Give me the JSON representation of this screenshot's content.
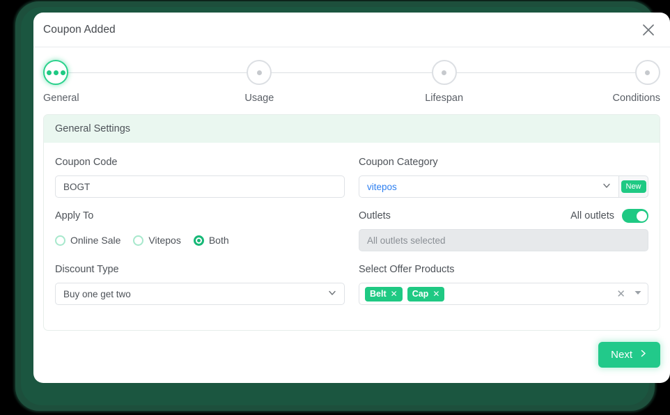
{
  "modal": {
    "title": "Coupon Added",
    "close_icon": "close-icon"
  },
  "stepper": {
    "steps": [
      {
        "label": "General",
        "state": "active"
      },
      {
        "label": "Usage",
        "state": "inactive"
      },
      {
        "label": "Lifespan",
        "state": "inactive"
      },
      {
        "label": "Conditions",
        "state": "inactive"
      }
    ]
  },
  "panel": {
    "header": "General Settings",
    "fields": {
      "coupon_code": {
        "label": "Coupon Code",
        "value": "BOGT",
        "placeholder": "Coupon Code"
      },
      "coupon_category": {
        "label": "Coupon Category",
        "value": "vitepos",
        "new_button": "New",
        "caret_icon": "chevron-down-icon"
      },
      "apply_to": {
        "label": "Apply To",
        "options": [
          {
            "label": "Online Sale",
            "selected": false
          },
          {
            "label": "Vitepos",
            "selected": false
          },
          {
            "label": "Both",
            "selected": true
          }
        ]
      },
      "outlets": {
        "label": "Outlets",
        "toggle_label": "All outlets",
        "toggle_on": true,
        "value": "All outlets selected",
        "disabled": true
      },
      "discount_type": {
        "label": "Discount Type",
        "value": "Buy one get two",
        "caret_icon": "chevron-down-icon"
      },
      "offer_products": {
        "label": "Select Offer Products",
        "tags": [
          "Belt",
          "Cap"
        ],
        "remove_icon": "close-small-icon",
        "clear_icon": "clear-icon",
        "caret_icon": "caret-down-icon"
      }
    }
  },
  "footer": {
    "next_label": "Next",
    "next_icon": "chevron-right-icon"
  },
  "colors": {
    "accent_green": "#1fc983",
    "panel_header": "#eaf7f0",
    "backdrop_green": "#1d4f3c",
    "link_blue": "#2d7ff0"
  }
}
